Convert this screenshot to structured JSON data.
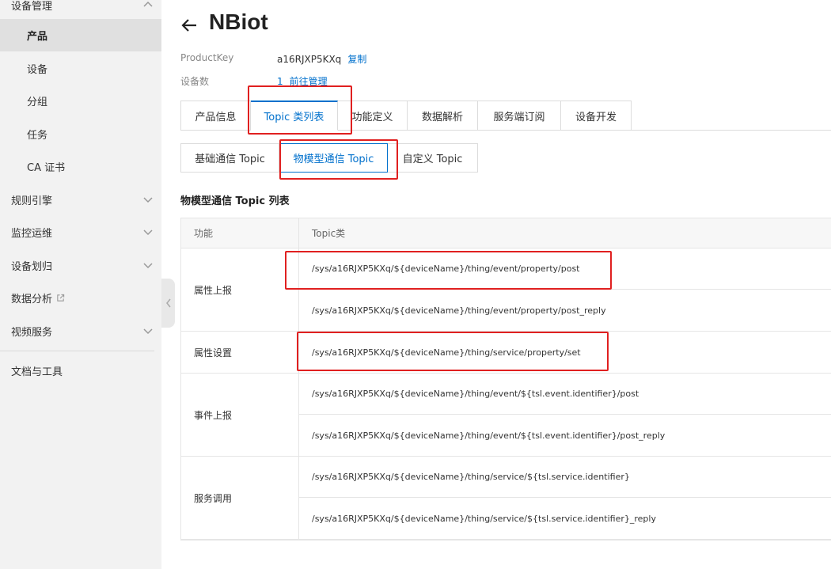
{
  "sidebar": {
    "group_device": "设备管理",
    "items": [
      {
        "label": "产品"
      },
      {
        "label": "设备"
      },
      {
        "label": "分组"
      },
      {
        "label": "任务"
      },
      {
        "label": "CA 证书"
      }
    ],
    "groups": [
      {
        "label": "规则引擎"
      },
      {
        "label": "监控运维"
      },
      {
        "label": "设备划归"
      },
      {
        "label": "数据分析"
      },
      {
        "label": "视频服务"
      }
    ],
    "docs": "文档与工具"
  },
  "header": {
    "title": "NBiot",
    "product_key_label": "ProductKey",
    "product_key_value": "a16RJXP5KXq",
    "copy_label": "复制",
    "device_count_label": "设备数",
    "device_count_value": "1",
    "manage_link": "前往管理"
  },
  "tabs": [
    {
      "label": "产品信息"
    },
    {
      "label": "Topic 类列表"
    },
    {
      "label": "功能定义"
    },
    {
      "label": "数据解析"
    },
    {
      "label": "服务端订阅"
    },
    {
      "label": "设备开发"
    }
  ],
  "subtabs": [
    {
      "label": "基础通信 Topic"
    },
    {
      "label": "物模型通信 Topic"
    },
    {
      "label": "自定义 Topic"
    }
  ],
  "section_title": "物模型通信 Topic 列表",
  "table": {
    "headers": [
      "功能",
      "Topic类"
    ],
    "groups": [
      {
        "func": "属性上报",
        "topics": [
          "/sys/a16RJXP5KXq/${deviceName}/thing/event/property/post",
          "/sys/a16RJXP5KXq/${deviceName}/thing/event/property/post_reply"
        ]
      },
      {
        "func": "属性设置",
        "topics": [
          "/sys/a16RJXP5KXq/${deviceName}/thing/service/property/set"
        ]
      },
      {
        "func": "事件上报",
        "topics": [
          "/sys/a16RJXP5KXq/${deviceName}/thing/event/${tsl.event.identifier}/post",
          "/sys/a16RJXP5KXq/${deviceName}/thing/event/${tsl.event.identifier}/post_reply"
        ]
      },
      {
        "func": "服务调用",
        "topics": [
          "/sys/a16RJXP5KXq/${deviceName}/thing/service/${tsl.service.identifier}",
          "/sys/a16RJXP5KXq/${deviceName}/thing/service/${tsl.service.identifier}_reply"
        ]
      }
    ]
  },
  "colors": {
    "accent": "#0070cc",
    "highlight": "#e02020"
  }
}
